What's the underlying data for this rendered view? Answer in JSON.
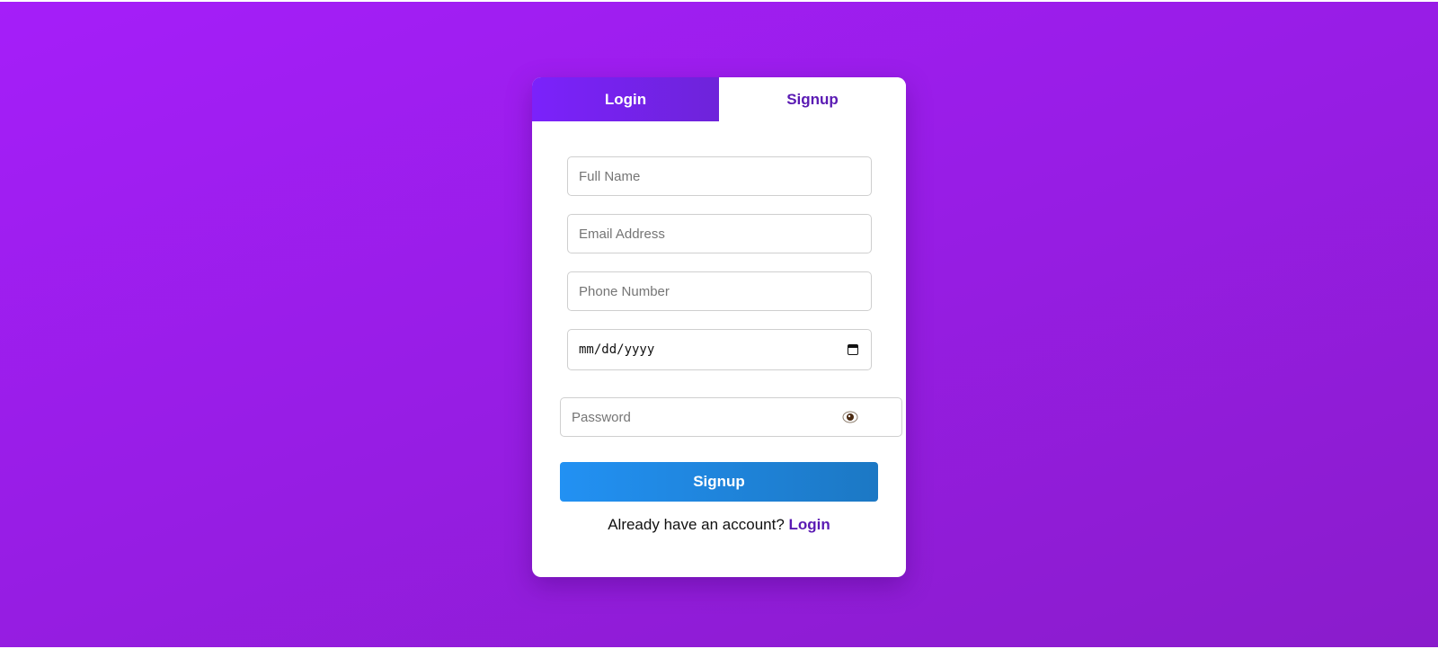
{
  "tabs": {
    "login_label": "Login",
    "signup_label": "Signup",
    "active": "Signup"
  },
  "form": {
    "full_name_placeholder": "Full Name",
    "email_placeholder": "Email Address",
    "phone_placeholder": "Phone Number",
    "dob_placeholder": "mm/dd/yyyy",
    "password_placeholder": "Password",
    "submit_label": "Signup"
  },
  "footer": {
    "prompt_text": "Already have an account?",
    "login_link": "Login"
  },
  "icons": {
    "calendar": "calendar-icon",
    "password_toggle": "eye-icon"
  },
  "colors": {
    "background_start": "#a51ef9",
    "background_end": "#8a1ccb",
    "tab_active_bg": "#7b22fb",
    "accent_text": "#5a1ab3",
    "button_start": "#2291f3",
    "button_end": "#1c78c4"
  }
}
